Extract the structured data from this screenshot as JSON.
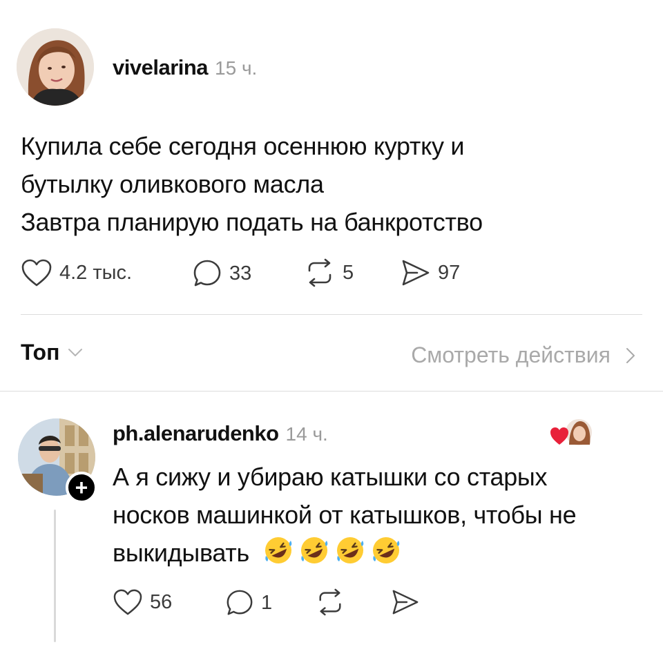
{
  "post": {
    "username": "vivelarina",
    "time": "15 ч.",
    "lines": [
      "Купила себе сегодня осеннюю куртку и",
      "бутылку оливкового масла",
      "Завтра планирую подать на банкротство"
    ],
    "likes": "4.2 тыс.",
    "comments": "33",
    "reposts": "5",
    "shares": "97"
  },
  "filters": {
    "sort_label": "Топ",
    "activity_label": "Смотреть действия"
  },
  "reply": {
    "username": "ph.alenarudenko",
    "time": "14 ч.",
    "lines": [
      "А я сижу и убираю катышки со старых",
      "носков машинкой от катышков, чтобы не",
      "выкидывать"
    ],
    "emojis": [
      "rolling-on-floor-laughing",
      "rolling-on-floor-laughing",
      "rolling-on-floor-laughing",
      "rolling-on-floor-laughing"
    ],
    "likes": "56",
    "comments": "1"
  },
  "colors": {
    "text": "#111111",
    "muted": "#9a9a9a",
    "divider": "#dcdcdc",
    "heart": "#e8213a"
  }
}
